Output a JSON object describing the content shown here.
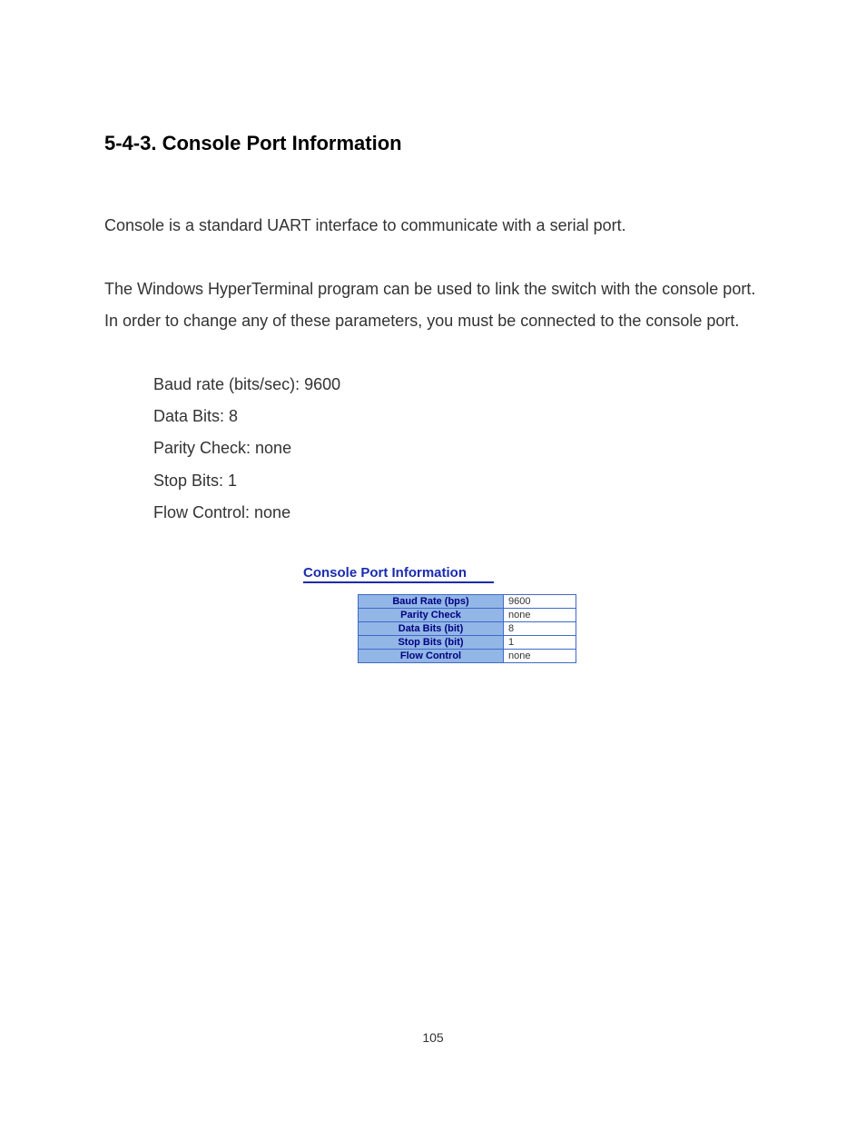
{
  "heading": "5-4-3. Console Port Information",
  "paragraph1": "Console is a standard UART interface to communicate with a serial port.",
  "paragraph2": "The Windows HyperTerminal program can be used to link the switch with the console port. In order to change any of these parameters, you must be connected to the console port.",
  "params": {
    "baud": "Baud rate (bits/sec): 9600",
    "databits": "Data Bits: 8",
    "parity": "Parity Check: none",
    "stopbits": "Stop Bits: 1",
    "flow": "Flow Control: none"
  },
  "panel_title": "Console Port Information",
  "table": {
    "rows": [
      {
        "label": "Baud Rate (bps)",
        "value": "9600"
      },
      {
        "label": "Parity Check",
        "value": "none"
      },
      {
        "label": "Data Bits (bit)",
        "value": "8"
      },
      {
        "label": "Stop Bits (bit)",
        "value": "1"
      },
      {
        "label": "Flow Control",
        "value": "none"
      }
    ]
  },
  "page_number": "105"
}
